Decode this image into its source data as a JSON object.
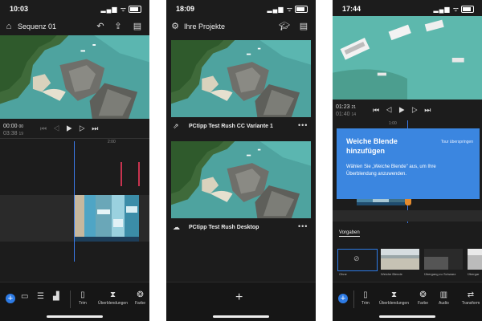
{
  "screen1": {
    "status_time": "10:03",
    "title": "Sequenz 01",
    "timecode_current": "00:00",
    "timecode_current_frames": "00",
    "timecode_total": "03:38",
    "timecode_total_frames": "19",
    "ruler_mark": "2:00",
    "toolbar": {
      "trim_label": "Trim",
      "transitions_label": "Überblendungen",
      "color_label": "Farbe"
    }
  },
  "screen2": {
    "status_time": "18:09",
    "title": "Ihre Projekte",
    "projects": [
      {
        "name": "PCtipp Test Rush CC Variante 1",
        "icon": "share-export-icon"
      },
      {
        "name": "PCtipp Test Rush Desktop",
        "icon": "cloud-icon"
      }
    ]
  },
  "screen3": {
    "status_time": "17:44",
    "timecode_current": "01:23",
    "timecode_current_frames": "21",
    "timecode_total": "01:40",
    "timecode_total_frames": "14",
    "ruler_mark": "1:00",
    "tooltip": {
      "title": "Weiche Blende hinzufügen",
      "skip": "Tour überspringen",
      "body": "Wählen Sie „Weiche Blende\" aus, um Ihre Überblendung anzuwenden."
    },
    "section_label": "Vorgaben",
    "presets": [
      "Ohne",
      "Weiche Blende",
      "Übergang zu Schwarz",
      "Übergar"
    ],
    "toolbar": {
      "trim_label": "Trim",
      "transitions_label": "Überblendungen",
      "color_label": "Farbe",
      "audio_label": "Audio",
      "transform_label": "Transform"
    }
  },
  "colors": {
    "accent": "#2d7be5",
    "playhead": "#3b7bea",
    "marker": "#c8334f",
    "tooltip": "#3b86e0",
    "background": "#1c1c1c"
  }
}
